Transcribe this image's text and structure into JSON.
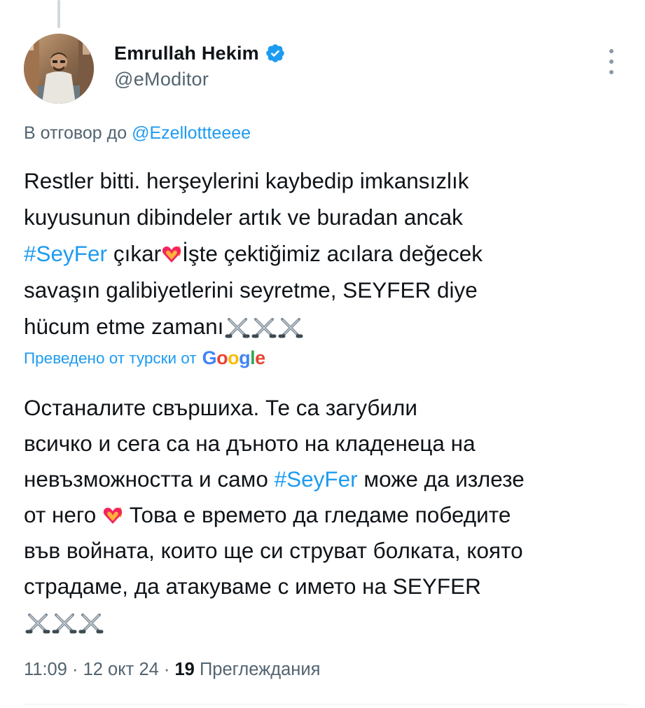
{
  "tweet": {
    "author": {
      "display_name": "Emrullah Hekim",
      "handle": "@eModitor",
      "verified": true,
      "verified_color": "#1d9bf0"
    },
    "reply_prefix": "В отговор до",
    "reply_to": "@Ezellottteeee",
    "original_text": {
      "line1": "Restler bitti. herşeylerini kaybedip imkansızlık",
      "line2": "kuyusunun dibindeler artık ve buradan ancak",
      "line3_hashtag": "#SeyFer",
      "line3_after": " çıkar",
      "line3_end": "İşte çektiğimiz acılara değecek",
      "line4": "savaşın galibiyetlerini seyretme, SEYFER diye",
      "line5": "hücum etme zamanı"
    },
    "translation_label": "Преведено от турски от",
    "translation_provider": "Google",
    "translated_text": {
      "line1": "Останалите свършиха. Те са загубили",
      "line2": "всичко и сега са на дъното на кладенеца на",
      "line3_before": "невъзможността и само ",
      "line3_hashtag": "#SeyFer",
      "line3_after": " може да излезе",
      "line4_before": "от него ",
      "line4_after": " Това е времето да гледаме победите",
      "line5": "във войната, които ще си струват болката, която",
      "line6": "страдаме, да атакуваме с името на SEYFER"
    },
    "emojis": {
      "heart": "heart-on-fire",
      "swords": "crossed-swords"
    },
    "time": "11:09",
    "date": "12 окт 24",
    "separator": "·",
    "views_count": "19",
    "views_label": "Преглеждания",
    "colors": {
      "link": "#1d9bf0",
      "text": "#0f1419",
      "secondary": "#536471"
    }
  }
}
